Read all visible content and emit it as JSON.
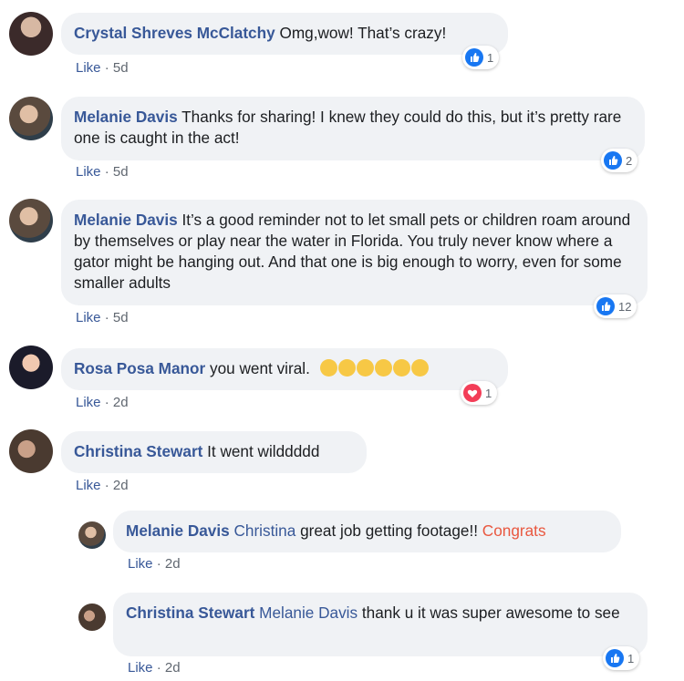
{
  "comments": [
    {
      "author": "Crystal Shreves McClatchy",
      "text": "Omg,wow! That’s crazy!",
      "like_label": "Like",
      "time": "5d",
      "reaction_count": "1"
    },
    {
      "author": "Melanie Davis",
      "text": "Thanks for sharing! I knew they could do this, but it’s pretty rare one is caught in the act!",
      "like_label": "Like",
      "time": "5d",
      "reaction_count": "2"
    },
    {
      "author": "Melanie Davis",
      "text": "It’s a good reminder not to let small pets or children roam around by themselves or play near the water in Florida. You truly never know where a gator might be hanging out. And that one is big enough to worry, even for some smaller adults",
      "like_label": "Like",
      "time": "5d",
      "reaction_count": "12"
    },
    {
      "author": "Rosa Posa Manor",
      "text": "you went viral.",
      "like_label": "Like",
      "time": "2d",
      "reaction_count": "1"
    },
    {
      "author": "Christina Stewart",
      "text": "It went wilddddd",
      "like_label": "Like",
      "time": "2d"
    }
  ],
  "replies": [
    {
      "author": "Melanie Davis",
      "mention": "Christina",
      "text": "great job getting footage!!",
      "highlight": "Congrats",
      "like_label": "Like",
      "time": "2d"
    },
    {
      "author": "Christina Stewart",
      "mention": "Melanie Davis",
      "text": "thank u it was super awesome to see",
      "like_label": "Like",
      "time": "2d",
      "reaction_count": "1"
    }
  ],
  "colors": {
    "author": "#385898",
    "bubble": "#f0f2f5",
    "like_icon": "#1877f2",
    "love_icon": "#f33e58",
    "highlight": "#e9573f"
  },
  "icons": {
    "like": "thumbs-up-icon",
    "love": "heart-icon",
    "emoji": "face-emoji-icon"
  }
}
